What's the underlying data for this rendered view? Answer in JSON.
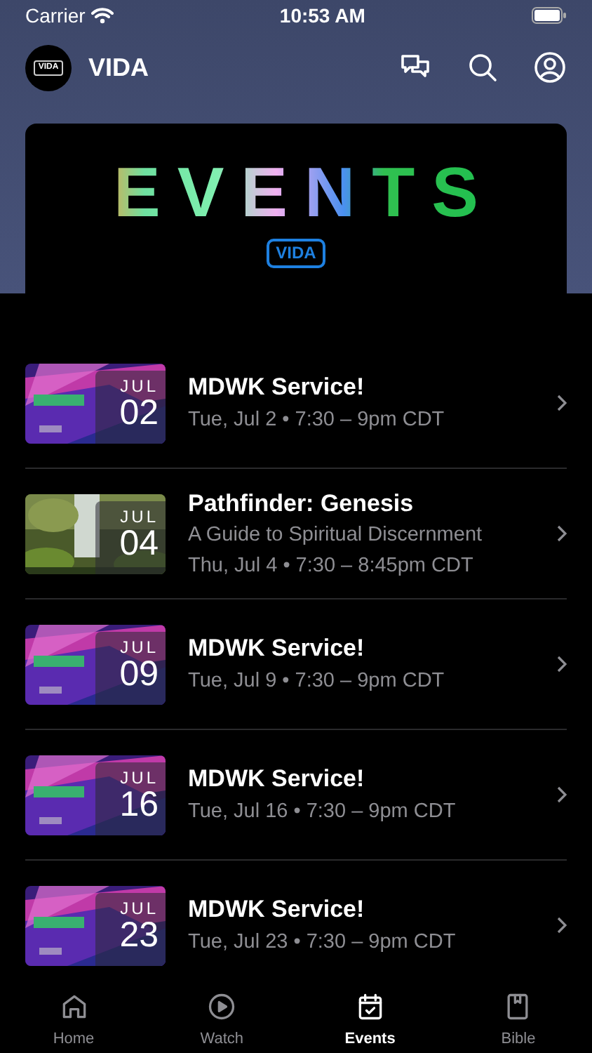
{
  "status_bar": {
    "carrier": "Carrier",
    "time": "10:53 AM"
  },
  "header": {
    "logo_text": "VIDA",
    "title": "VIDA"
  },
  "banner": {
    "title": "EVENTS",
    "badge": "VIDA"
  },
  "events": [
    {
      "month": "JUL",
      "day": "02",
      "title": "MDWK Service!",
      "when": "Tue, Jul 2 • 7:30 – 9pm CDT"
    },
    {
      "month": "JUL",
      "day": "04",
      "title": "Pathfinder: Genesis",
      "subtitle": "A Guide to Spiritual Discernment",
      "when": "Thu, Jul 4 • 7:30 – 8:45pm CDT"
    },
    {
      "month": "JUL",
      "day": "09",
      "title": "MDWK Service!",
      "when": "Tue, Jul 9 • 7:30 – 9pm CDT"
    },
    {
      "month": "JUL",
      "day": "16",
      "title": "MDWK Service!",
      "when": "Tue, Jul 16 • 7:30 – 9pm CDT"
    },
    {
      "month": "JUL",
      "day": "23",
      "title": "MDWK Service!",
      "when": "Tue, Jul 23 • 7:30 – 9pm CDT"
    }
  ],
  "tabs": [
    {
      "label": "Home",
      "selected": false
    },
    {
      "label": "Watch",
      "selected": false
    },
    {
      "label": "Events",
      "selected": true
    },
    {
      "label": "Bible",
      "selected": false
    }
  ]
}
